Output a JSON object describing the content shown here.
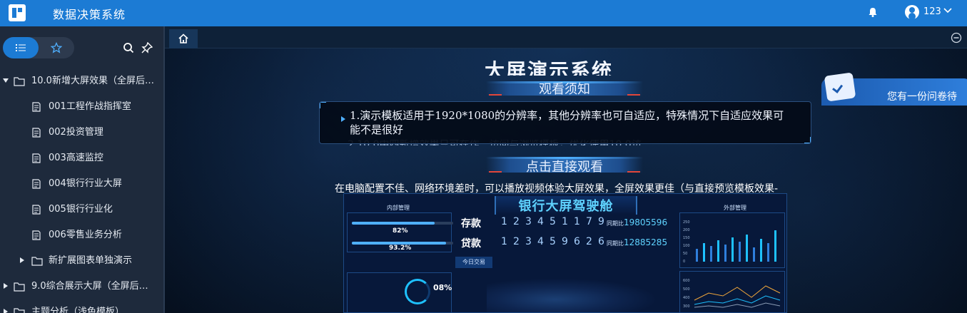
{
  "app": {
    "title": "数据决策系统"
  },
  "user": {
    "name": "123"
  },
  "sidebar": {
    "tabs": [
      {
        "name": "list",
        "icon": "list-icon",
        "active": true
      },
      {
        "name": "favorites",
        "icon": "star-icon",
        "active": false
      }
    ],
    "items": [
      {
        "label": "10.0新增大屏效果（全屏后…",
        "type": "folder",
        "expanded": true
      },
      {
        "label": "001工程作战指挥室",
        "type": "report"
      },
      {
        "label": "002投资管理",
        "type": "report"
      },
      {
        "label": "003高速监控",
        "type": "report"
      },
      {
        "label": "004银行行业大屏",
        "type": "report"
      },
      {
        "label": "005银行行业化",
        "type": "report"
      },
      {
        "label": "006零售业务分析",
        "type": "report"
      },
      {
        "label": "新扩展图表单独演示",
        "type": "folder",
        "expanded": false
      },
      {
        "label": "9.0综合展示大屏（全屏后…",
        "type": "folder",
        "expanded": false
      },
      {
        "label": "主题分析（浅色模板）",
        "type": "folder",
        "expanded": false
      }
    ]
  },
  "stage": {
    "title": "大屏演示系统",
    "notice_title": "观看须知",
    "notice_text": "1.演示模板适用于1920*1080的分辨率，其他分辨率也可自适应，特殊情况下自适应效果可能不是很好",
    "notice_hint": "2.10.0中四新增效果只可在作…访问与浏览模板，优化使用10.0访",
    "watch_title": "点击直接观看",
    "video_tip": "在电脑配置不佳、网络环境差时，可以播放视频体验大屏效果，全屏效果更佳（与直接预览模板效果-",
    "survey_text": "您有一份问卷待"
  },
  "preview": {
    "title": "银行大屏驾驶舱",
    "left_title": "内部管理",
    "right_title": "外部管理",
    "bar1": {
      "value": 0.82,
      "label": "82%"
    },
    "bar2": {
      "value": 0.932,
      "label": "93.2%"
    },
    "deposit": {
      "label": "存款",
      "digits": [
        "1",
        "2",
        "3",
        "4",
        "5",
        "1",
        "1",
        "7",
        "9"
      ],
      "cmp_label": "同期比",
      "cmp_value": "19805596"
    },
    "loan": {
      "label": "贷款",
      "digits": [
        "1",
        "2",
        "3",
        "4",
        "5",
        "9",
        "6",
        "2",
        "6"
      ],
      "cmp_label": "同期比",
      "cmp_value": "12885285"
    },
    "today_btn": "今日交易",
    "gauge_value": "08%",
    "right_axis": [
      "250",
      "200",
      "150",
      "100",
      "50",
      "0"
    ],
    "right2_axis": [
      "600",
      "500",
      "400",
      "300"
    ],
    "accent": "#5fd3ff"
  },
  "colors": {
    "topbar": "#1c7bd4",
    "sidebar": "#1e2a3c",
    "stage": "#071528"
  }
}
